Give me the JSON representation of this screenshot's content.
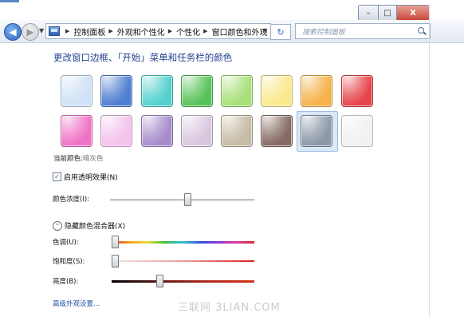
{
  "window": {
    "caption_buttons": {
      "min": "–",
      "max": "□",
      "close": "X"
    }
  },
  "nav": {
    "back_icon": "arrow-left-icon",
    "forward_icon": "arrow-right-icon",
    "breadcrumbs": [
      "控制面板",
      "外观和个性化",
      "个性化",
      "窗口颜色和外观"
    ],
    "refresh_symbol": "↻",
    "search_placeholder": "搜索控制面板"
  },
  "content": {
    "title": "更改窗口边框、「开始」菜单和任务栏的颜色",
    "swatches": [
      {
        "name": "sky",
        "color": "#cfe2f7"
      },
      {
        "name": "twilight",
        "color": "#4f7fd1"
      },
      {
        "name": "sea",
        "color": "#54d1cd"
      },
      {
        "name": "leaf",
        "color": "#58c35a"
      },
      {
        "name": "lime",
        "color": "#a8e07a"
      },
      {
        "name": "pumpkin-light",
        "color": "#fbe98e"
      },
      {
        "name": "pumpkin",
        "color": "#f6b24a"
      },
      {
        "name": "ruby",
        "color": "#e6454a"
      },
      {
        "name": "fuchsia",
        "color": "#f073c6"
      },
      {
        "name": "blush",
        "color": "#f3c3ec"
      },
      {
        "name": "violet",
        "color": "#a68ccb"
      },
      {
        "name": "lavender",
        "color": "#d9c7df"
      },
      {
        "name": "taupe",
        "color": "#c6bba4"
      },
      {
        "name": "chocolate",
        "color": "#856a63"
      },
      {
        "name": "slate",
        "color": "#8e99a8",
        "selected": true
      },
      {
        "name": "frost",
        "color": "#f1f1f1"
      }
    ],
    "current_color_label": "当前颜色:",
    "current_color_value": "暗灰色",
    "transparency_label": "启用透明效果(N)",
    "transparency_checked": true,
    "intensity_label": "颜色浓度(I):",
    "intensity_value": 0.54,
    "mixer_label": "隐藏颜色混合器(X)",
    "hue_label": "色调(U):",
    "hue_value": 0.0,
    "saturation_label": "饱和度(S):",
    "saturation_value": 0.0,
    "brightness_label": "亮度(B):",
    "brightness_value": 0.33,
    "advanced_link": "高级外观设置...",
    "watermark": "三联网 3LIAN.COM"
  }
}
